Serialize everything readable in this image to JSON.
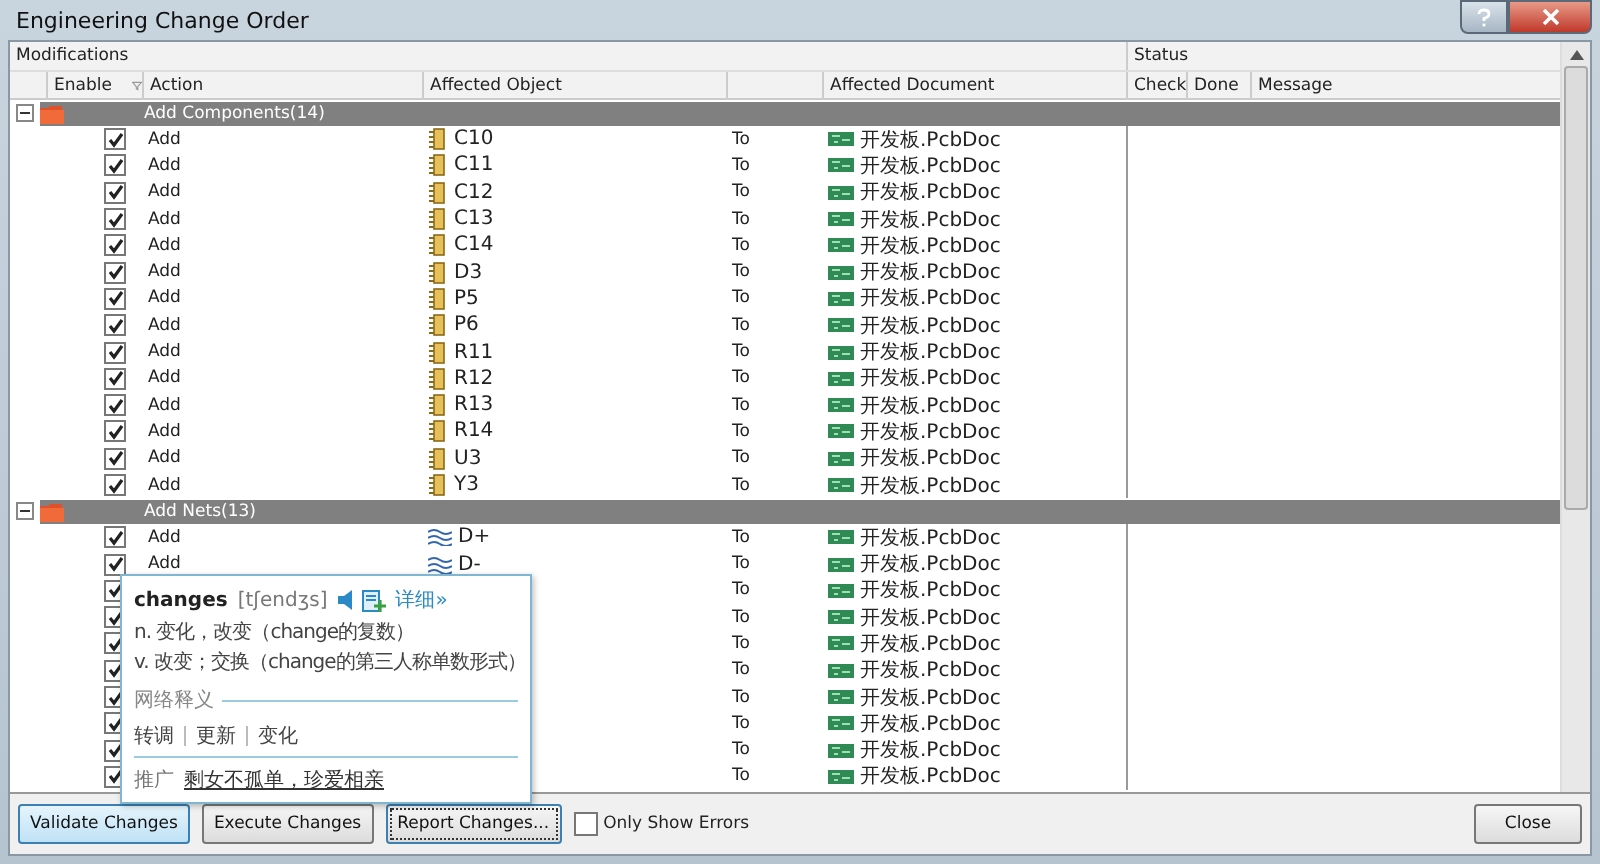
{
  "window": {
    "title": "Engineering Change Order"
  },
  "header": {
    "modifications": "Modifications",
    "status": "Status"
  },
  "columns": {
    "enable": "Enable",
    "action": "Action",
    "object": "Affected Object",
    "document": "Affected Document",
    "check": "Check",
    "done": "Done",
    "message": "Message"
  },
  "groups": [
    {
      "label": "Add Components(14)",
      "expanded": true,
      "rows": [
        {
          "enabled": true,
          "action": "Add",
          "kind": "component",
          "object": "C10",
          "direction": "To",
          "document": "开发板.PcbDoc"
        },
        {
          "enabled": true,
          "action": "Add",
          "kind": "component",
          "object": "C11",
          "direction": "To",
          "document": "开发板.PcbDoc"
        },
        {
          "enabled": true,
          "action": "Add",
          "kind": "component",
          "object": "C12",
          "direction": "To",
          "document": "开发板.PcbDoc"
        },
        {
          "enabled": true,
          "action": "Add",
          "kind": "component",
          "object": "C13",
          "direction": "To",
          "document": "开发板.PcbDoc"
        },
        {
          "enabled": true,
          "action": "Add",
          "kind": "component",
          "object": "C14",
          "direction": "To",
          "document": "开发板.PcbDoc"
        },
        {
          "enabled": true,
          "action": "Add",
          "kind": "component",
          "object": "D3",
          "direction": "To",
          "document": "开发板.PcbDoc"
        },
        {
          "enabled": true,
          "action": "Add",
          "kind": "component",
          "object": "P5",
          "direction": "To",
          "document": "开发板.PcbDoc"
        },
        {
          "enabled": true,
          "action": "Add",
          "kind": "component",
          "object": "P6",
          "direction": "To",
          "document": "开发板.PcbDoc"
        },
        {
          "enabled": true,
          "action": "Add",
          "kind": "component",
          "object": "R11",
          "direction": "To",
          "document": "开发板.PcbDoc"
        },
        {
          "enabled": true,
          "action": "Add",
          "kind": "component",
          "object": "R12",
          "direction": "To",
          "document": "开发板.PcbDoc"
        },
        {
          "enabled": true,
          "action": "Add",
          "kind": "component",
          "object": "R13",
          "direction": "To",
          "document": "开发板.PcbDoc"
        },
        {
          "enabled": true,
          "action": "Add",
          "kind": "component",
          "object": "R14",
          "direction": "To",
          "document": "开发板.PcbDoc"
        },
        {
          "enabled": true,
          "action": "Add",
          "kind": "component",
          "object": "U3",
          "direction": "To",
          "document": "开发板.PcbDoc"
        },
        {
          "enabled": true,
          "action": "Add",
          "kind": "component",
          "object": "Y3",
          "direction": "To",
          "document": "开发板.PcbDoc"
        }
      ]
    },
    {
      "label": "Add Nets(13)",
      "expanded": true,
      "rows": [
        {
          "enabled": true,
          "action": "Add",
          "kind": "net",
          "object": "D+",
          "direction": "To",
          "document": "开发板.PcbDoc"
        },
        {
          "enabled": true,
          "action": "Add",
          "kind": "net",
          "object": "D-",
          "direction": "To",
          "document": "开发板.PcbDoc"
        },
        {
          "enabled": true,
          "direction": "To",
          "document": "开发板.PcbDoc"
        },
        {
          "enabled": true,
          "direction": "To",
          "document": "开发板.PcbDoc"
        },
        {
          "enabled": true,
          "direction": "To",
          "document": "开发板.PcbDoc"
        },
        {
          "enabled": true,
          "direction": "To",
          "document": "开发板.PcbDoc"
        },
        {
          "enabled": true,
          "direction": "To",
          "document": "开发板.PcbDoc"
        },
        {
          "enabled": true,
          "direction": "To",
          "document": "开发板.PcbDoc"
        },
        {
          "enabled": true,
          "direction": "To",
          "document": "开发板.PcbDoc"
        },
        {
          "enabled": true,
          "direction": "To",
          "document": "开发板.PcbDoc"
        }
      ]
    }
  ],
  "popup": {
    "word": "changes",
    "phonetic": "[tʃendʒs]",
    "detail_link": "详细»",
    "definitions": [
      "n. 变化，改变（change的复数）",
      "v. 改变；交换（change的第三人称单数形式）"
    ],
    "web_heading": "网络释义",
    "web_terms": [
      "转调",
      "更新",
      "变化"
    ],
    "promo_label": "推广",
    "promo_link": "剩女不孤单，珍爱相亲"
  },
  "buttons": [
    {
      "label": "Validate Changes",
      "highlighted": true,
      "focused": false
    },
    {
      "label": "Execute Changes",
      "highlighted": false,
      "focused": false
    },
    {
      "label": "Report Changes...",
      "highlighted": false,
      "focused": true
    }
  ],
  "only_show_errors": {
    "label": "Only Show Errors",
    "checked": false
  },
  "close_button": "Close"
}
